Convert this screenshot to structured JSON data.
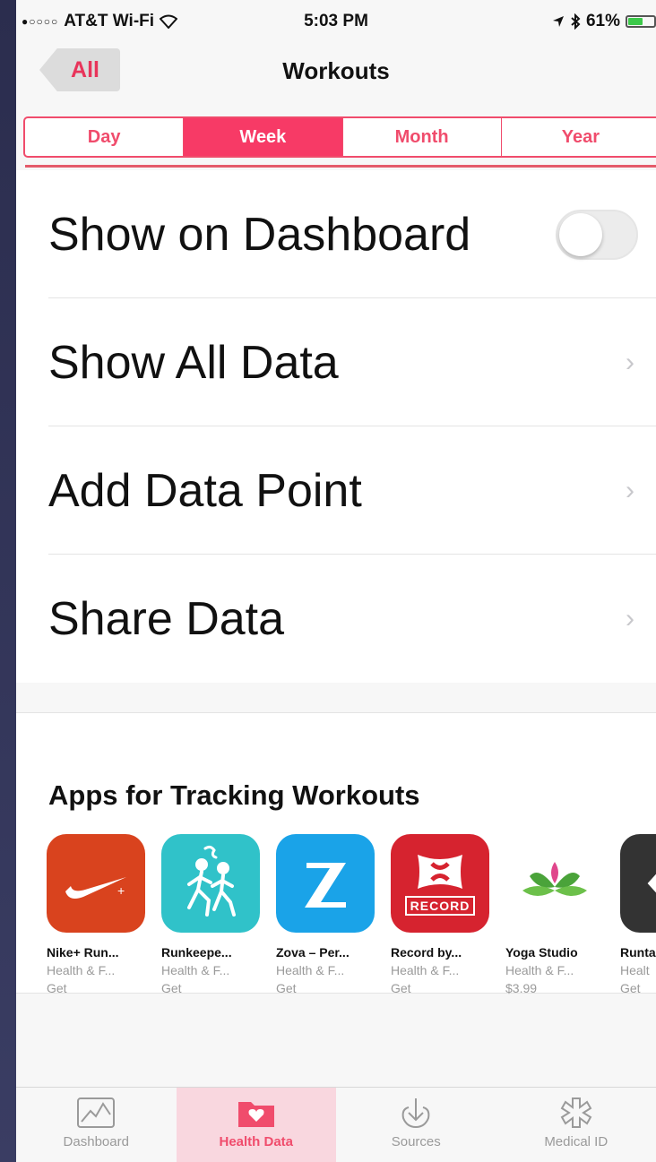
{
  "status_bar": {
    "carrier": "AT&T Wi-Fi",
    "signal_dots": "●○○○○",
    "time": "5:03 PM",
    "battery": "61%",
    "battery_level": 0.61
  },
  "nav": {
    "back_label": "All",
    "title": "Workouts"
  },
  "segments": [
    {
      "label": "Day",
      "active": false
    },
    {
      "label": "Week",
      "active": true
    },
    {
      "label": "Month",
      "active": false
    },
    {
      "label": "Year",
      "active": false
    }
  ],
  "rows": {
    "show_on_dashboard": {
      "label": "Show on Dashboard",
      "toggle_on": false
    },
    "show_all_data": {
      "label": "Show All Data"
    },
    "add_data_point": {
      "label": "Add Data Point"
    },
    "share_data": {
      "label": "Share Data"
    }
  },
  "apps_section": {
    "title": "Apps for Tracking Workouts",
    "apps": [
      {
        "name": "Nike+ Run...",
        "category": "Health & F...",
        "price": "Get",
        "color": "#d9431e"
      },
      {
        "name": "Runkeepe...",
        "category": "Health & F...",
        "price": "Get",
        "color": "#30c2c9"
      },
      {
        "name": "Zova – Per...",
        "category": "Health & F...",
        "price": "Get",
        "color": "#1aa3e8"
      },
      {
        "name": "Record by...",
        "category": "Health & F...",
        "price": "Get",
        "color": "#d6232f"
      },
      {
        "name": "Yoga Studio",
        "category": "Health & F...",
        "price": "$3.99",
        "color": "#ffffff"
      },
      {
        "name": "Runta",
        "category": "Healt",
        "price": "Get",
        "color": "#333333"
      }
    ],
    "record_icon_text": "RECORD"
  },
  "tab_bar": {
    "items": [
      {
        "label": "Dashboard",
        "icon": "dashboard-chart-icon",
        "active": false
      },
      {
        "label": "Health Data",
        "icon": "heart-folder-icon",
        "active": true
      },
      {
        "label": "Sources",
        "icon": "download-arrow-icon",
        "active": false
      },
      {
        "label": "Medical ID",
        "icon": "medical-star-icon",
        "active": false
      }
    ]
  },
  "colors": {
    "accent": "#f73a66",
    "toggle_off": "#ececec",
    "chevron": "#c8c8cc"
  }
}
